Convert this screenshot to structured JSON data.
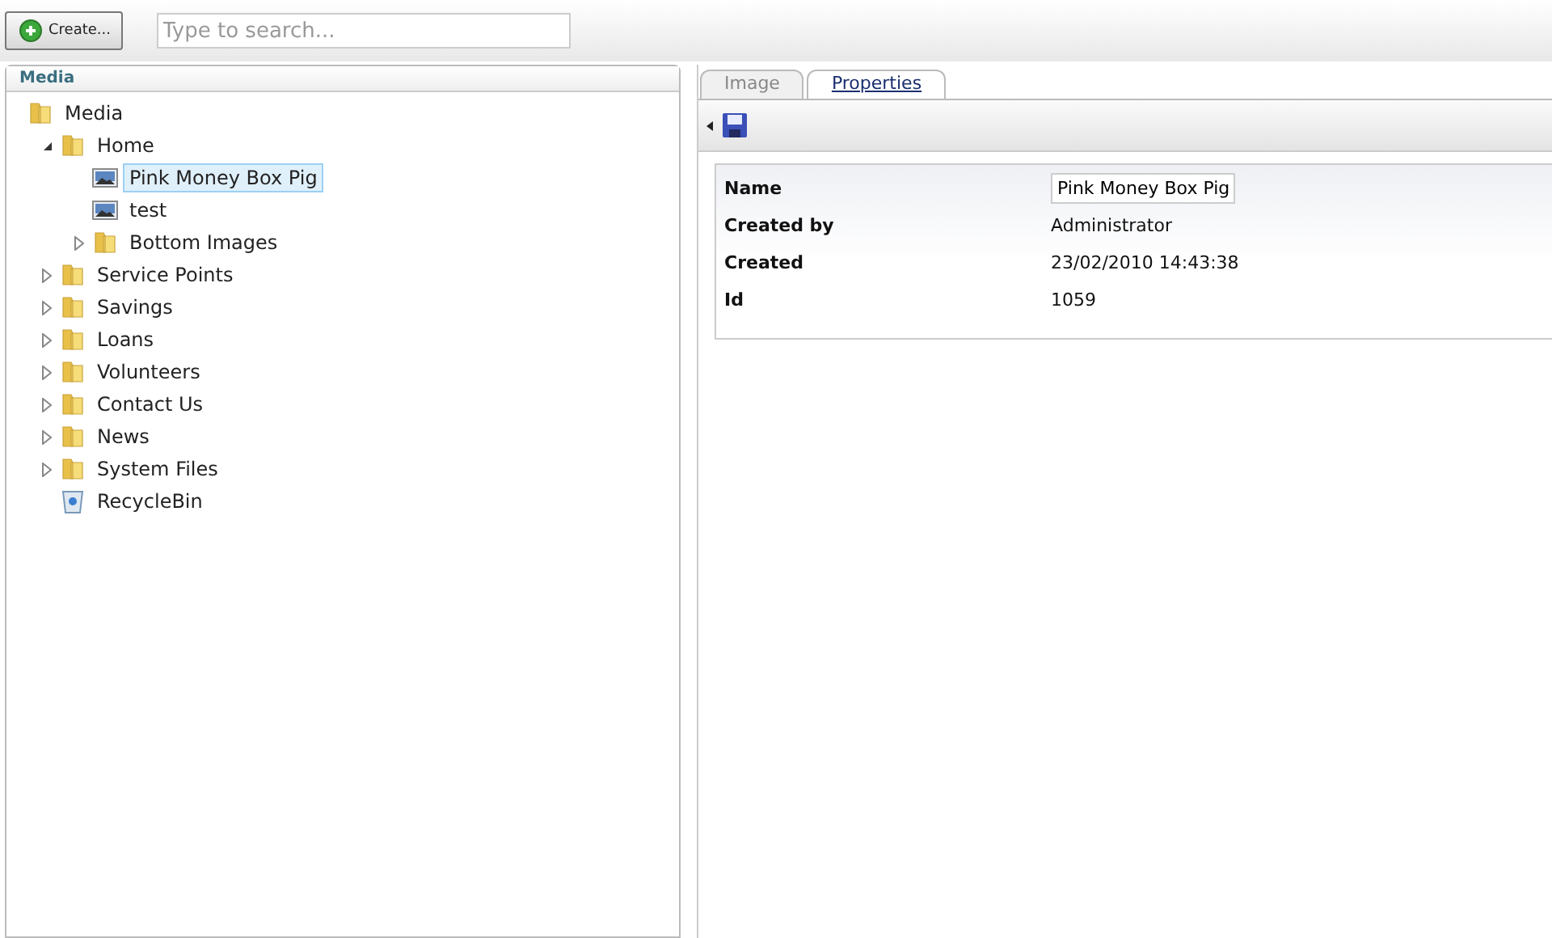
{
  "toolbar": {
    "create_button": "Create...",
    "search": {
      "placeholder": "Type to search..."
    }
  },
  "media_panel": {
    "title": "Media",
    "tree": [
      {
        "label": "Media",
        "kind": "folder",
        "selected": false,
        "children": [
          {
            "label": "Home",
            "kind": "folder",
            "expanded": true,
            "selected": false,
            "children": [
              {
                "label": "Pink Money Box Pig",
                "kind": "image",
                "selected": true
              },
              {
                "label": "test",
                "kind": "image",
                "selected": false
              },
              {
                "label": "Bottom Images",
                "kind": "folder",
                "expanded": false,
                "selected": false
              }
            ]
          },
          {
            "label": "Service Points",
            "kind": "folder",
            "expanded": false,
            "selected": false
          },
          {
            "label": "Savings",
            "kind": "folder",
            "expanded": false,
            "selected": false
          },
          {
            "label": "Loans",
            "kind": "folder",
            "expanded": false,
            "selected": false
          },
          {
            "label": "Volunteers",
            "kind": "folder",
            "expanded": false,
            "selected": false
          },
          {
            "label": "Contact Us",
            "kind": "folder",
            "expanded": false,
            "selected": false
          },
          {
            "label": "News",
            "kind": "folder",
            "expanded": false,
            "selected": false
          },
          {
            "label": "System Files",
            "kind": "folder",
            "expanded": false,
            "selected": false
          },
          {
            "label": "RecycleBin",
            "kind": "recycle",
            "selected": false
          }
        ]
      }
    ]
  },
  "editor": {
    "tabs": [
      {
        "label": "Image",
        "selected": false
      },
      {
        "label": "Properties",
        "selected": true
      }
    ],
    "properties": [
      {
        "label": "Name",
        "kind": "input",
        "value": "Pink Money Box Pig"
      },
      {
        "label": "Created by",
        "kind": "text",
        "value": "Administrator"
      },
      {
        "label": "Created",
        "kind": "text",
        "value": "23/02/2010 14:43:38"
      },
      {
        "label": "Id",
        "kind": "text",
        "value": "1059"
      }
    ]
  }
}
